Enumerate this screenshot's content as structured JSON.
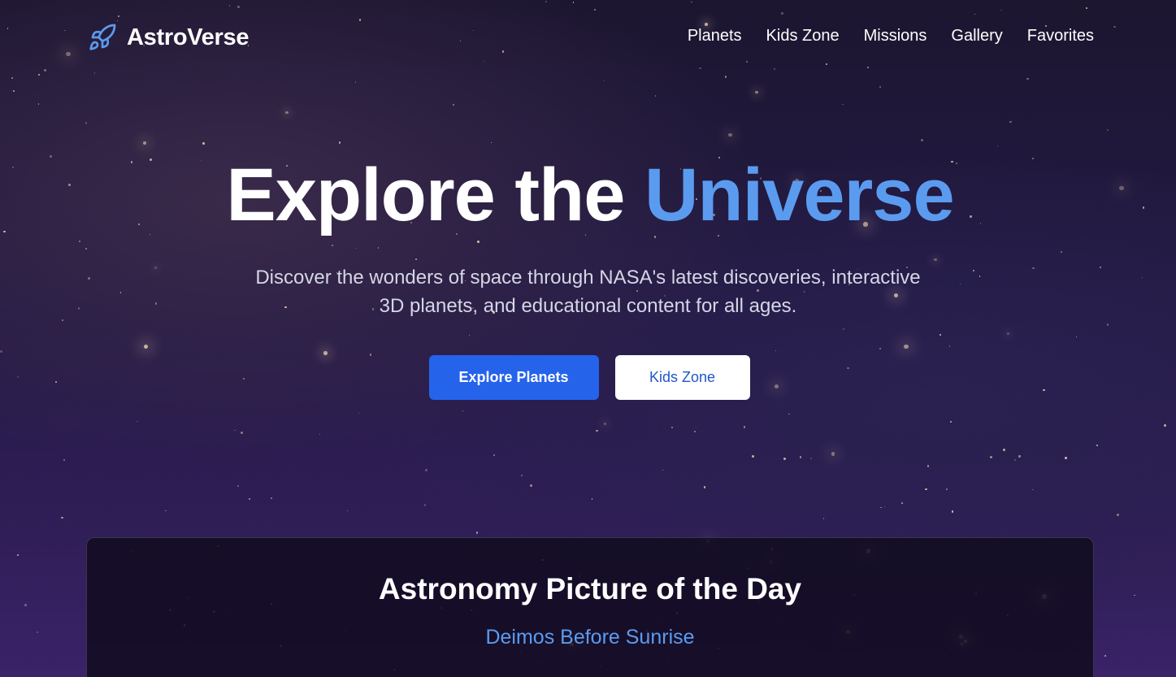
{
  "brand": {
    "name": "AstroVerse",
    "icon": "rocket-icon"
  },
  "nav": {
    "items": [
      {
        "label": "Planets"
      },
      {
        "label": "Kids Zone"
      },
      {
        "label": "Missions"
      },
      {
        "label": "Gallery"
      },
      {
        "label": "Favorites"
      }
    ]
  },
  "hero": {
    "title_main": "Explore the ",
    "title_accent": "Universe",
    "subtitle": "Discover the wonders of space through NASA's latest discoveries, interactive 3D planets, and educational content for all ages.",
    "primary_button": "Explore Planets",
    "secondary_button": "Kids Zone"
  },
  "apod": {
    "heading": "Astronomy Picture of the Day",
    "image_title": "Deimos Before Sunrise"
  },
  "colors": {
    "accent": "#5b9bef",
    "primary_button": "#2563eb",
    "background_top": "#1c1630",
    "background_bottom": "#3a2368"
  }
}
